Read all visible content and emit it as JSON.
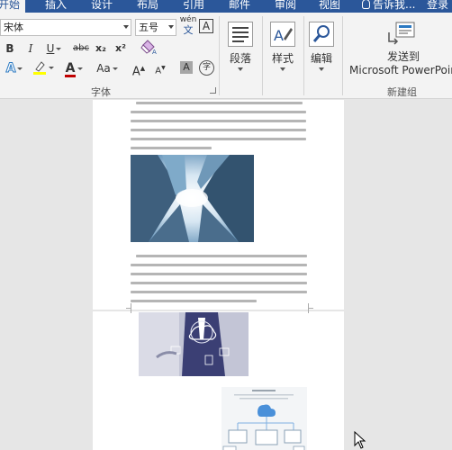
{
  "tabs": {
    "home": "开始",
    "insert": "插入",
    "design": "设计",
    "layout": "布局",
    "references": "引用",
    "mailings": "邮件",
    "review": "审阅",
    "view": "视图",
    "tell_me": "告诉我...",
    "login": "登录"
  },
  "font_group": {
    "font_name": "宋体",
    "font_size": "五号",
    "wen_glyph": "wén",
    "wen_glyph_sub": "文",
    "bold": "B",
    "italic": "I",
    "underline": "U",
    "strikethrough": "abc",
    "subscript": "x₂",
    "superscript": "x²",
    "font_color_letter": "A",
    "case_label": "Aa",
    "grow_font": "A",
    "shrink_font": "A",
    "char_shading": "A",
    "enclose_char": "字",
    "text_effects": "A",
    "char_border": "A",
    "label": "字体"
  },
  "paragraph_button": {
    "label": "段落"
  },
  "styles_button": {
    "label": "样式"
  },
  "editing_button": {
    "label": "编辑"
  },
  "send_button": {
    "line1": "发送到",
    "line2": "Microsoft PowerPoint"
  },
  "new_group_label": "新建组",
  "colors": {
    "tab_bar": "#2b579a",
    "ribbon_bg": "#f3f3f3",
    "doc_bg": "#e6e6e6",
    "font_color_bar": "#c00000",
    "highlight_bar": "#ffff00"
  }
}
